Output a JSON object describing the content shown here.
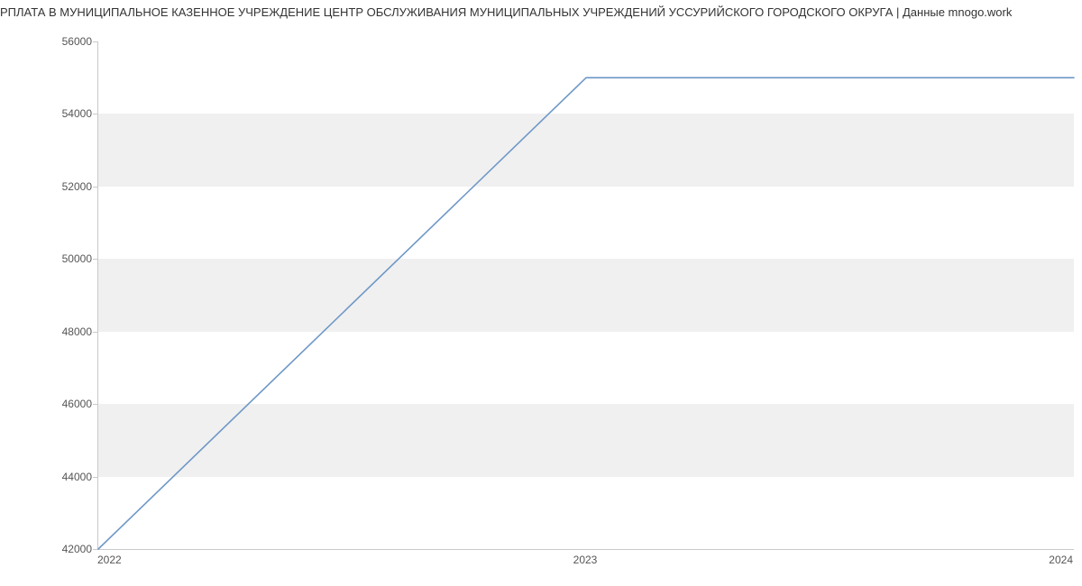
{
  "chart_data": {
    "type": "line",
    "title": "РПЛАТА В МУНИЦИПАЛЬНОЕ КАЗЕННОЕ УЧРЕЖДЕНИЕ ЦЕНТР ОБСЛУЖИВАНИЯ МУНИЦИПАЛЬНЫХ УЧРЕЖДЕНИЙ УССУРИЙСКОГО ГОРОДСКОГО ОКРУГА | Данные mnogo.work",
    "x": [
      2022,
      2023,
      2024
    ],
    "values": [
      42000,
      55000,
      55000
    ],
    "xlabel": "",
    "ylabel": "",
    "xlim": [
      2022,
      2024
    ],
    "ylim": [
      42000,
      56000
    ],
    "xticks": [
      2022,
      2023,
      2024
    ],
    "yticks": [
      42000,
      44000,
      46000,
      48000,
      50000,
      52000,
      54000,
      56000
    ],
    "grid": true
  },
  "colors": {
    "line": "#6f98c7",
    "band": "#f0f0f0",
    "axis": "#c9c9c9"
  }
}
